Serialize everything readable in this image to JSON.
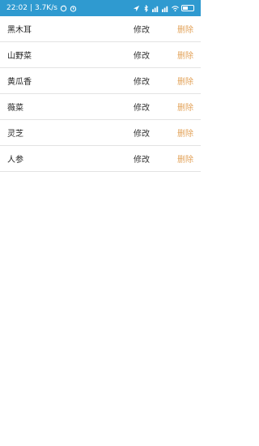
{
  "status_bar": {
    "time": "22:02",
    "speed": "3.7K/s",
    "battery_level": 0.5
  },
  "items": [
    {
      "name": "黑木耳",
      "edit_label": "修改",
      "delete_label": "删除"
    },
    {
      "name": "山野菜",
      "edit_label": "修改",
      "delete_label": "删除"
    },
    {
      "name": "黄瓜香",
      "edit_label": "修改",
      "delete_label": "删除"
    },
    {
      "name": "薇菜",
      "edit_label": "修改",
      "delete_label": "删除"
    },
    {
      "name": "灵芝",
      "edit_label": "修改",
      "delete_label": "删除"
    },
    {
      "name": "人参",
      "edit_label": "修改",
      "delete_label": "删除"
    }
  ],
  "colors": {
    "status_bar": "#2f9ad0",
    "delete": "#e3a35a"
  }
}
